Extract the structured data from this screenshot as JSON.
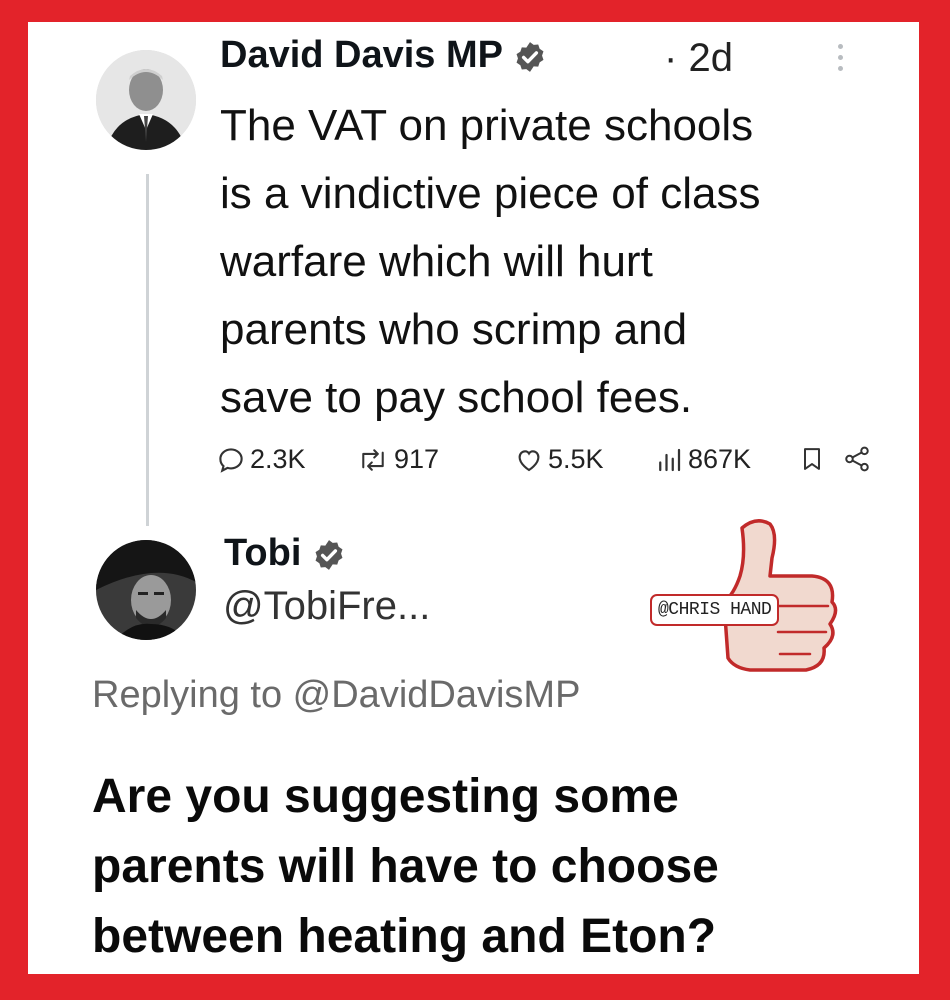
{
  "original_post": {
    "author": "David Davis MP",
    "separator": "·",
    "time": "2d",
    "avatar_icon": "portrait-photo-man-suit",
    "body_lines": [
      "The VAT on private schools",
      "is a vindictive piece of class",
      "warfare which will hurt",
      "parents who scrimp and",
      "save to pay school fees."
    ],
    "stats": {
      "replies": "2.3K",
      "reposts": "917",
      "likes": "5.5K",
      "views": "867K"
    }
  },
  "reply": {
    "author": "Tobi",
    "handle": "@TobiFre...",
    "avatar_icon": "portrait-photo-man-hat",
    "replying_to": "Replying to @DavidDavisMP",
    "body_lines": [
      "Are you suggesting some",
      "parents will have to choose",
      "between heating and Eton?"
    ]
  },
  "watermark": {
    "text": "@CHRIS HAND",
    "icon": "thumbs-up-sticker-icon"
  },
  "colors": {
    "frame": "#e3232a",
    "card": "#ffffff",
    "text": "#0f1419",
    "muted": "#6a6a6a",
    "verified": "#555555"
  }
}
